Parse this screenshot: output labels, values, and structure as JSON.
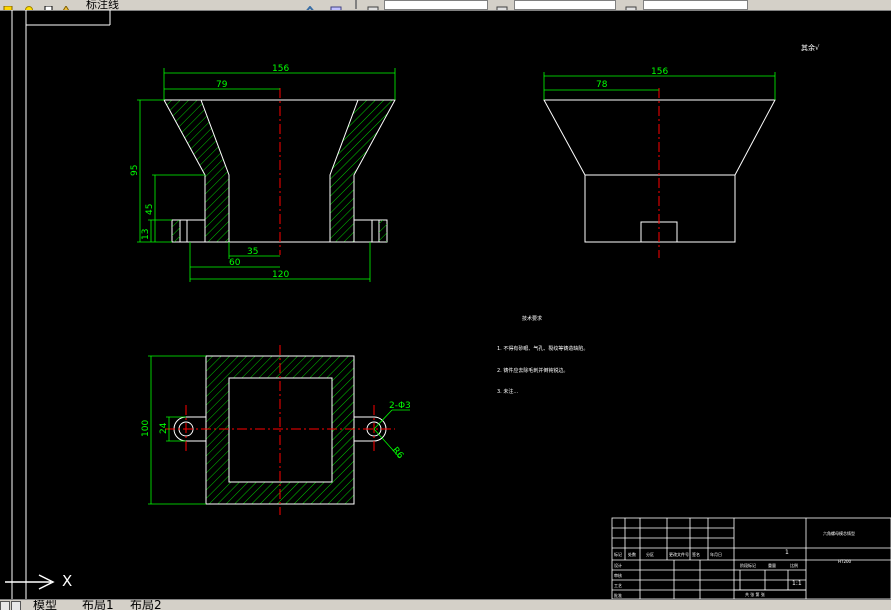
{
  "toolbar": {
    "layer_name": "标注线",
    "icons": [
      "layer-state-icon",
      "sun-icon",
      "layer-color-icon",
      "match-layer-icon",
      "layer-previous-icon",
      "properties-icon"
    ],
    "color_field": "",
    "linetype_field": "",
    "lineweight_field": ""
  },
  "layout_tabs": [
    "模型",
    "布局1",
    "布局2"
  ],
  "ucs": {
    "label": "X"
  },
  "drawing": {
    "colors": {
      "background": "#000000",
      "outline": "#ffffff",
      "dimension": "#00ff00",
      "centerline": "#ff0000",
      "hatch": "#00ff00",
      "frame": "#ffffff"
    },
    "front_view": {
      "dim_top": "156",
      "dim_half": "79",
      "dim_height": "95",
      "dim_mid": "45",
      "dim_base": "13",
      "dim_inner": "35",
      "dim_60": "60",
      "dim_120": "120"
    },
    "side_view": {
      "dim_top": "156",
      "dim_half": "78"
    },
    "top_view": {
      "dim_height": "100",
      "dim_ear": "24",
      "dim_hole": "2-Φ3",
      "dim_radius": "R6"
    },
    "roughness_note": "其余√",
    "tech_requirements": {
      "title": "技术要求",
      "items": [
        "1. 不得有砂眼、气孔、裂纹等铸造缺陷。",
        "2. 铸件应去除毛刺并倒钝锐边。",
        "3. 未注..."
      ]
    },
    "title_block": {
      "drawing_name": "六角螺母模芯铸型",
      "material": "HT200",
      "scale": "1:1",
      "qty": "1",
      "row_labels": [
        "标记",
        "处数",
        "分区",
        "更改文件号",
        "签名",
        "年月日"
      ],
      "side_labels": [
        "设计",
        "审核",
        "工艺",
        "批准"
      ],
      "stage_label": "阶段标记",
      "weight_label": "重量",
      "scale_label": "比例",
      "sheet_label": "共 张 第 张"
    }
  }
}
